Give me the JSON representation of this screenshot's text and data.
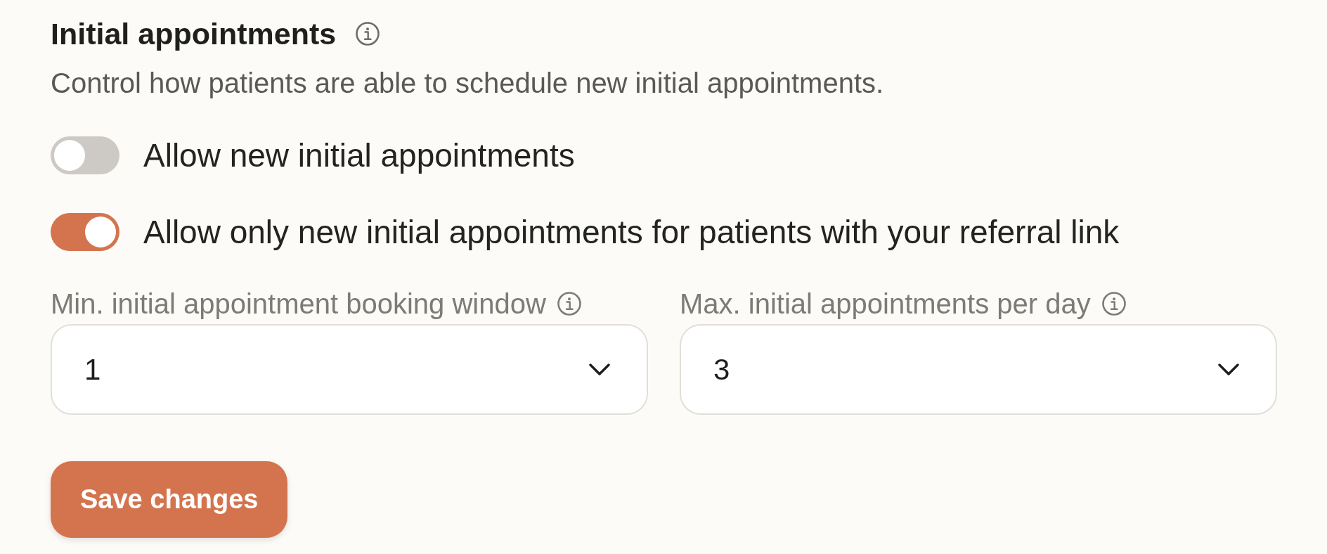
{
  "section": {
    "title": "Initial appointments",
    "description": "Control how patients are able to schedule new initial appointments."
  },
  "toggles": [
    {
      "label": "Allow new initial appointments",
      "on": false
    },
    {
      "label": "Allow only new initial appointments for patients with your referral link",
      "on": true
    }
  ],
  "fields": [
    {
      "label": "Min. initial appointment booking window",
      "value": "1"
    },
    {
      "label": "Max. initial appointments per day",
      "value": "3"
    }
  ],
  "save_button": {
    "label": "Save changes"
  }
}
